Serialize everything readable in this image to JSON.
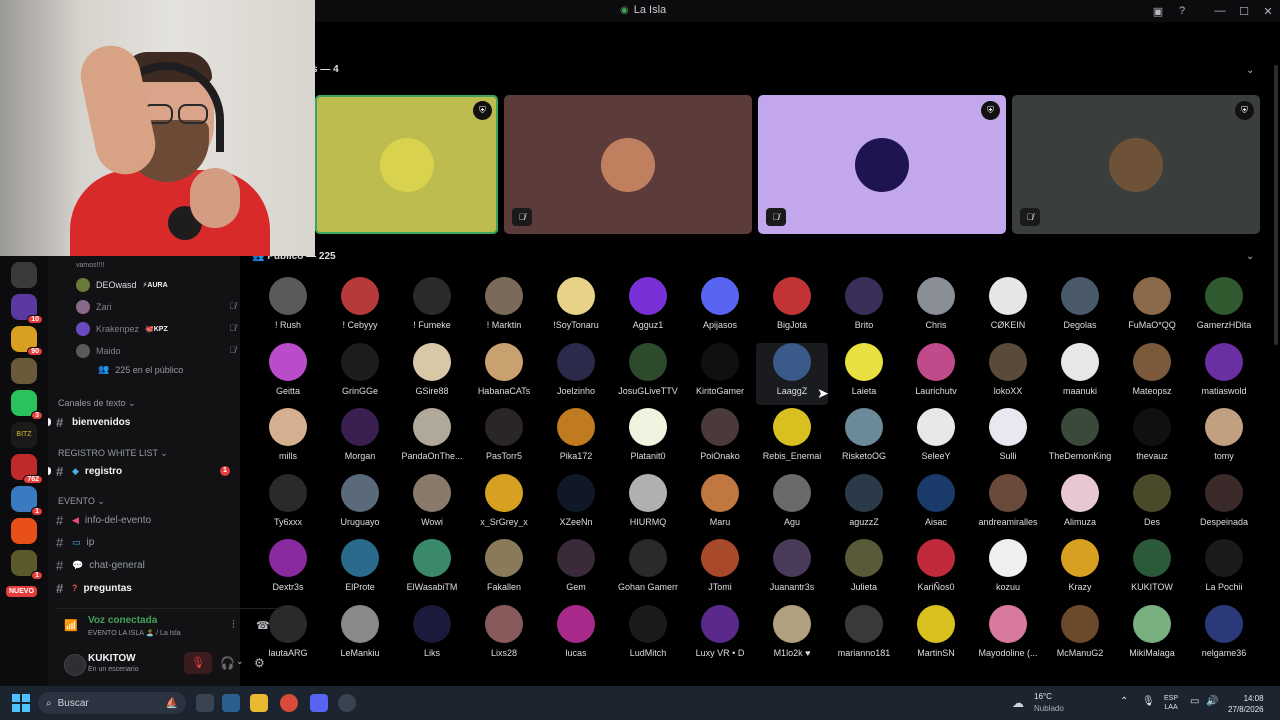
{
  "window": {
    "title": "La Isla"
  },
  "stage": {
    "speakers_header": "s — 4",
    "tiles": [
      {
        "name": "tile-speaker-1",
        "bg": "#bcbc4f",
        "avatar": "#d9d24e",
        "muted": false,
        "border": "#3ba55c"
      },
      {
        "name": "tile-speaker-2",
        "bg": "#5c3c3a",
        "avatar": "#c08060",
        "muted": true
      },
      {
        "name": "tile-speaker-3",
        "bg": "#c3a7ec",
        "avatar": "#1e1550",
        "muted": true
      },
      {
        "name": "tile-speaker-4",
        "bg": "#3a3e3c",
        "avatar": "#6d5238",
        "muted": true
      }
    ],
    "audience_header": "Público — 225"
  },
  "audience": [
    {
      "name": "! Rush",
      "c": "#5a5a5a"
    },
    {
      "name": "! Cebyyy",
      "c": "#b73a3a"
    },
    {
      "name": "! Fumeke",
      "c": "#2a2a2a"
    },
    {
      "name": "! Marktin",
      "c": "#7a6a5a"
    },
    {
      "name": "!SoyTonaru",
      "c": "#e8d28a"
    },
    {
      "name": "Agguz1",
      "c": "#7b2fd6"
    },
    {
      "name": "Apijasos",
      "c": "#5865f2"
    },
    {
      "name": "BigJota",
      "c": "#c23434"
    },
    {
      "name": "Brito",
      "c": "#3b2e5a"
    },
    {
      "name": "Chris",
      "c": "#8a8f96"
    },
    {
      "name": "CØKEIN",
      "c": "#e6e6e6"
    },
    {
      "name": "Degolas",
      "c": "#4a5a6a"
    },
    {
      "name": "FuMaO*QQ",
      "c": "#8a6a4a"
    },
    {
      "name": "GamerzHDita",
      "c": "#2f5a2f"
    },
    {
      "name": "Geitta",
      "c": "#b84cc9"
    },
    {
      "name": "GrinGGe",
      "c": "#1c1c1c"
    },
    {
      "name": "GSire88",
      "c": "#d8c8a8"
    },
    {
      "name": "HabanaCATs",
      "c": "#c9a070"
    },
    {
      "name": "Joelzinho",
      "c": "#2a2a4a"
    },
    {
      "name": "JosuGLiveTTV",
      "c": "#2d4a2d"
    },
    {
      "name": "KiritoGamer",
      "c": "#101010"
    },
    {
      "name": "LaaggZ",
      "c": "#3a5a8a"
    },
    {
      "name": "Laieta",
      "c": "#e8e040"
    },
    {
      "name": "Laurichutv",
      "c": "#c04a8a"
    },
    {
      "name": "lokoXX",
      "c": "#5a4a3a"
    },
    {
      "name": "maanuki",
      "c": "#e8e8e8"
    },
    {
      "name": "Mateopsz",
      "c": "#7a5a3a"
    },
    {
      "name": "matiaswold",
      "c": "#6a2fa0"
    },
    {
      "name": "mills",
      "c": "#d4b090"
    },
    {
      "name": "Morgan",
      "c": "#3a2050"
    },
    {
      "name": "PandaOnThe...",
      "c": "#b0a898"
    },
    {
      "name": "PasTorr5",
      "c": "#2a2626"
    },
    {
      "name": "Pika172",
      "c": "#c07a20"
    },
    {
      "name": "Platanit0",
      "c": "#f2f2e0"
    },
    {
      "name": "PoiOnako",
      "c": "#4a3a3a"
    },
    {
      "name": "Rebis_Enemai",
      "c": "#d8c020"
    },
    {
      "name": "RisketoOG",
      "c": "#6a8a9a"
    },
    {
      "name": "SeleeY",
      "c": "#e8e8e8"
    },
    {
      "name": "Sulli",
      "c": "#e8e8f0"
    },
    {
      "name": "TheDemonKing",
      "c": "#3a4a3a"
    },
    {
      "name": "thevauz",
      "c": "#101010"
    },
    {
      "name": "tomy",
      "c": "#c0a080"
    },
    {
      "name": "Ty6xxx",
      "c": "#2a2a2a"
    },
    {
      "name": "Uruguayo",
      "c": "#5a6a7a"
    },
    {
      "name": "Wowi",
      "c": "#8a7a6a"
    },
    {
      "name": "x_SrGrey_x",
      "c": "#d8a020"
    },
    {
      "name": "XZeeNn",
      "c": "#101828"
    },
    {
      "name": "HIURMQ",
      "c": "#b0b0b0"
    },
    {
      "name": "Maru",
      "c": "#c07840"
    },
    {
      "name": "Agu",
      "c": "#6a6a6a"
    },
    {
      "name": "aguzzZ",
      "c": "#2a3a4a"
    },
    {
      "name": "Aisac",
      "c": "#1a3a6a"
    },
    {
      "name": "andreamiralles",
      "c": "#6a4a3a"
    },
    {
      "name": "Alimuza",
      "c": "#e8c8d0"
    },
    {
      "name": "Des",
      "c": "#4a4a2a"
    },
    {
      "name": "Despeinada",
      "c": "#3a2a2a"
    },
    {
      "name": "Dextr3s",
      "c": "#8a2aa0"
    },
    {
      "name": "ElProte",
      "c": "#2a6a8a"
    },
    {
      "name": "ElWasabiTM",
      "c": "#3a8a6a"
    },
    {
      "name": "Fakallen",
      "c": "#8a7a5a"
    },
    {
      "name": "Gem",
      "c": "#3a2a3a"
    },
    {
      "name": "Gohan Gamerr",
      "c": "#2a2a2a"
    },
    {
      "name": "JTomi",
      "c": "#a84a2a"
    },
    {
      "name": "Juanantr3s",
      "c": "#4a3a5a"
    },
    {
      "name": "Julieta",
      "c": "#5a5a3a"
    },
    {
      "name": "KariÑos0",
      "c": "#c02a3a"
    },
    {
      "name": "kozuu",
      "c": "#f0f0f0"
    },
    {
      "name": "Krazy",
      "c": "#d8a020"
    },
    {
      "name": "KUKITOW",
      "c": "#2a5a3a"
    },
    {
      "name": "La Pochii",
      "c": "#1a1a1a"
    },
    {
      "name": "lautaARG",
      "c": "#2a2a2a"
    },
    {
      "name": "LeMankiu",
      "c": "#8a8a8a"
    },
    {
      "name": "Liks",
      "c": "#1a1a3a"
    },
    {
      "name": "Lixs28",
      "c": "#8a5a5a"
    },
    {
      "name": "lucas",
      "c": "#a82a8a"
    },
    {
      "name": "LudMitch",
      "c": "#1a1a1a"
    },
    {
      "name": "Luxy VR • D",
      "c": "#5a2a8a"
    },
    {
      "name": "M1lo2k ♥",
      "c": "#b0a080"
    },
    {
      "name": "marianno181",
      "c": "#3a3a3a"
    },
    {
      "name": "MartinSN",
      "c": "#d8c020"
    },
    {
      "name": "Mayodoline (...",
      "c": "#d87aa0"
    },
    {
      "name": "McManuG2",
      "c": "#6a4a2a"
    },
    {
      "name": "MikiMalaga",
      "c": "#7ab080"
    },
    {
      "name": "nelgame36",
      "c": "#2a3a7a"
    }
  ],
  "sidebar": {
    "vc_message": "vamos!!!!",
    "voice_users": [
      {
        "name": "DEOwasd",
        "tag": "⚡AURA",
        "dim": false,
        "c": "#6a7a3a"
      },
      {
        "name": "Zari",
        "tag": "",
        "dim": true,
        "c": "#8a6a8a"
      },
      {
        "name": "Krakenpez",
        "tag": "🐙KPZ",
        "dim": true,
        "c": "#6a4ac0"
      },
      {
        "name": "Maido",
        "tag": "",
        "dim": true,
        "c": "#5a5a5a"
      }
    ],
    "public_count": "225 en el público",
    "cat_text": "Canales de texto",
    "chan_bienvenidos": "bienvenidos",
    "cat_registro": "REGISTRO WHITE LIST",
    "chan_registro": "registro",
    "registro_badge": "1",
    "cat_evento": "EVENTO",
    "chan_info": "info-del-evento",
    "chan_ip": "ip",
    "chan_chat": "chat-general",
    "chan_preguntas": "preguntas",
    "nuevo": "NUEVO"
  },
  "voice": {
    "title": "Voz conectada",
    "subtitle": "EVENTO LA ISLA 🏝️ / La Isla"
  },
  "user": {
    "name": "KUKITOW",
    "status": "En un escenario"
  },
  "rail_badges": {
    "b1": "10",
    "b2": "90",
    "b3": "3",
    "b4": "762",
    "b5": "1",
    "b6": "1"
  },
  "taskbar": {
    "search": "Buscar",
    "temp": "16°C",
    "weather": "Nublado",
    "lang1": "ESP",
    "lang2": "LAA",
    "time": "14:08",
    "date": "27/8/2026"
  }
}
